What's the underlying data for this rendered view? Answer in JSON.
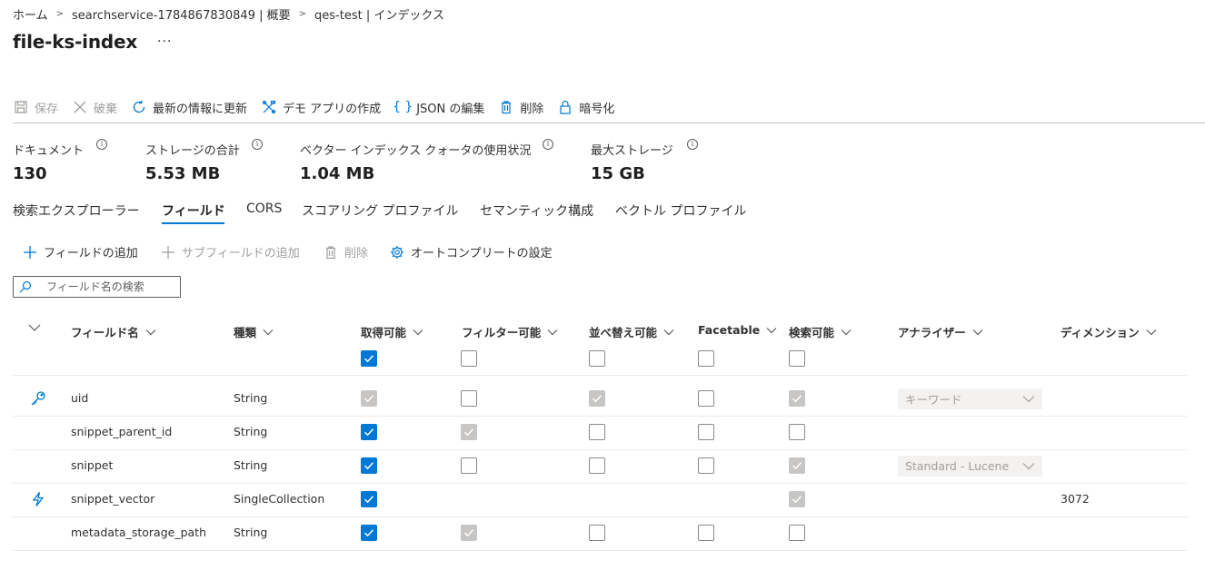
{
  "breadcrumb": [
    "ホーム",
    "searchservice-1784867830849 | 概要",
    "qes-test | インデックス"
  ],
  "title": "file-ks-index",
  "more_label": "···",
  "toolbar": {
    "save": "保存",
    "discard": "破棄",
    "refresh": "最新の情報に更新",
    "demo": "デモ アプリの作成",
    "json": "JSON の編集",
    "delete": "削除",
    "encrypt": "暗号化"
  },
  "stats": [
    {
      "label": "ドキュメント",
      "value": "130"
    },
    {
      "label": "ストレージの合計",
      "value": "5.53 MB"
    },
    {
      "label": "ベクター インデックス クォータの使用状況",
      "value": "1.04 MB"
    },
    {
      "label": "最大ストレージ",
      "value": "15 GB"
    }
  ],
  "tabs": [
    "検索エクスプローラー",
    "フィールド",
    "CORS",
    "スコアリング プロファイル",
    "セマンティック構成",
    "ベクトル プロファイル"
  ],
  "active_tab": "フィールド",
  "fields_toolbar": {
    "add_field": "フィールドの追加",
    "add_subfield": "サブフィールドの追加",
    "delete": "削除",
    "autocomplete": "オートコンプリートの設定"
  },
  "search": {
    "placeholder": "フィールド名の検索"
  },
  "columns": {
    "name": "フィールド名",
    "type": "種類",
    "retrievable": "取得可能",
    "filterable": "フィルター可能",
    "sortable": "並べ替え可能",
    "facetable": "Facetable",
    "searchable": "検索可能",
    "analyzer": "アナライザー",
    "dimensions": "ディメンション"
  },
  "header_checks": {
    "retrievable": true,
    "filterable": false,
    "sortable": false,
    "facetable": false,
    "searchable": false
  },
  "rows": [
    {
      "icon": "key-icon",
      "name": "uid",
      "type": "String",
      "retrievable": "checked-disabled",
      "filterable": "unchecked",
      "sortable": "checked-disabled",
      "facetable": "unchecked",
      "searchable": "checked-disabled",
      "analyzer": "キーワード",
      "dimensions": ""
    },
    {
      "icon": "",
      "name": "snippet_parent_id",
      "type": "String",
      "retrievable": "checked",
      "filterable": "checked-disabled",
      "sortable": "unchecked",
      "facetable": "unchecked",
      "searchable": "unchecked",
      "analyzer": "",
      "dimensions": ""
    },
    {
      "icon": "",
      "name": "snippet",
      "type": "String",
      "retrievable": "checked",
      "filterable": "unchecked",
      "sortable": "unchecked",
      "facetable": "unchecked",
      "searchable": "checked-disabled",
      "analyzer": "Standard - Lucene",
      "dimensions": ""
    },
    {
      "icon": "lightning-icon",
      "name": "snippet_vector",
      "type": "SingleCollection",
      "retrievable": "checked",
      "filterable": "none",
      "sortable": "none",
      "facetable": "none",
      "searchable": "checked-disabled",
      "analyzer": "",
      "dimensions": "3072"
    },
    {
      "icon": "",
      "name": "metadata_storage_path",
      "type": "String",
      "retrievable": "checked",
      "filterable": "checked-disabled",
      "sortable": "unchecked",
      "facetable": "unchecked",
      "searchable": "unchecked",
      "analyzer": "",
      "dimensions": ""
    }
  ],
  "colors": {
    "accent": "#0078d4",
    "disabled": "#c8c6c4",
    "text": "#323130"
  }
}
